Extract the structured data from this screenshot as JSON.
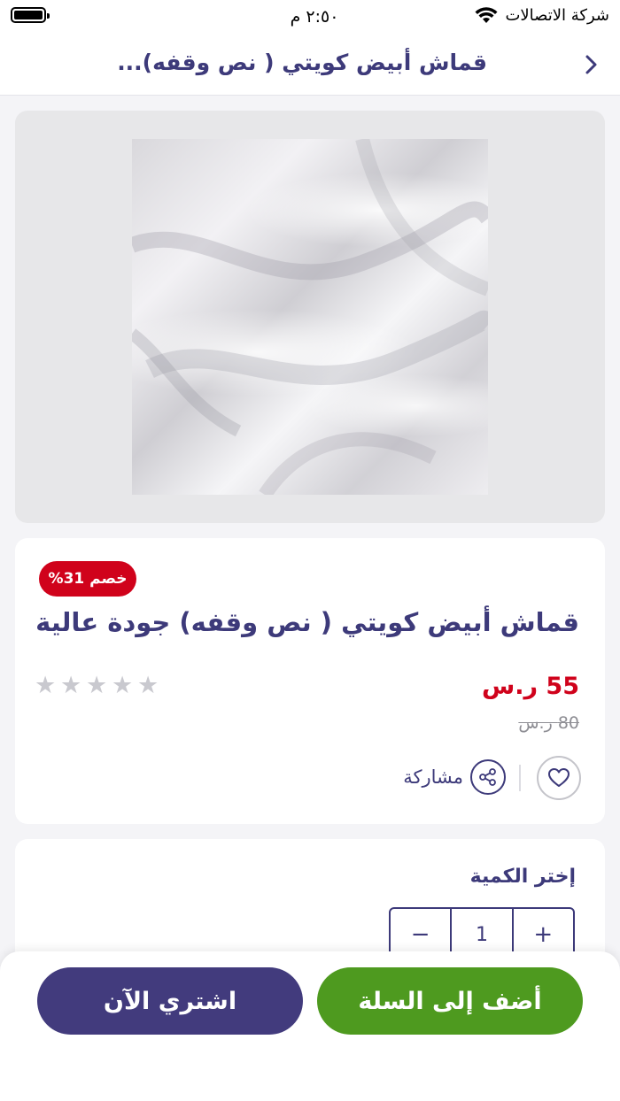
{
  "status_bar": {
    "time": "٢:٥٠ م",
    "carrier": "شركة الاتصالات"
  },
  "header": {
    "title": "قماش أبيض كويتي ( نص وقفه)...",
    "back_icon": "chevron-right-icon"
  },
  "product": {
    "image_alt": "white fabric",
    "discount_badge": "خصم 31%",
    "title": "قماش أبيض كويتي ( نص وقفه) جودة عالية",
    "price": "55 ر.س",
    "old_price": "80 ر.س",
    "rating_stars": 5,
    "share_label": "مشاركة"
  },
  "quantity": {
    "label": "إختر الكمية",
    "value": "1",
    "minus": "−",
    "plus": "+"
  },
  "actions": {
    "add_to_cart": "أضف إلى السلة",
    "buy_now": "اشتري الآن"
  },
  "colors": {
    "primary": "#3d3a7a",
    "discount": "#d0021b",
    "cart_button": "#4e9a1f",
    "buy_button": "#423b7d"
  }
}
